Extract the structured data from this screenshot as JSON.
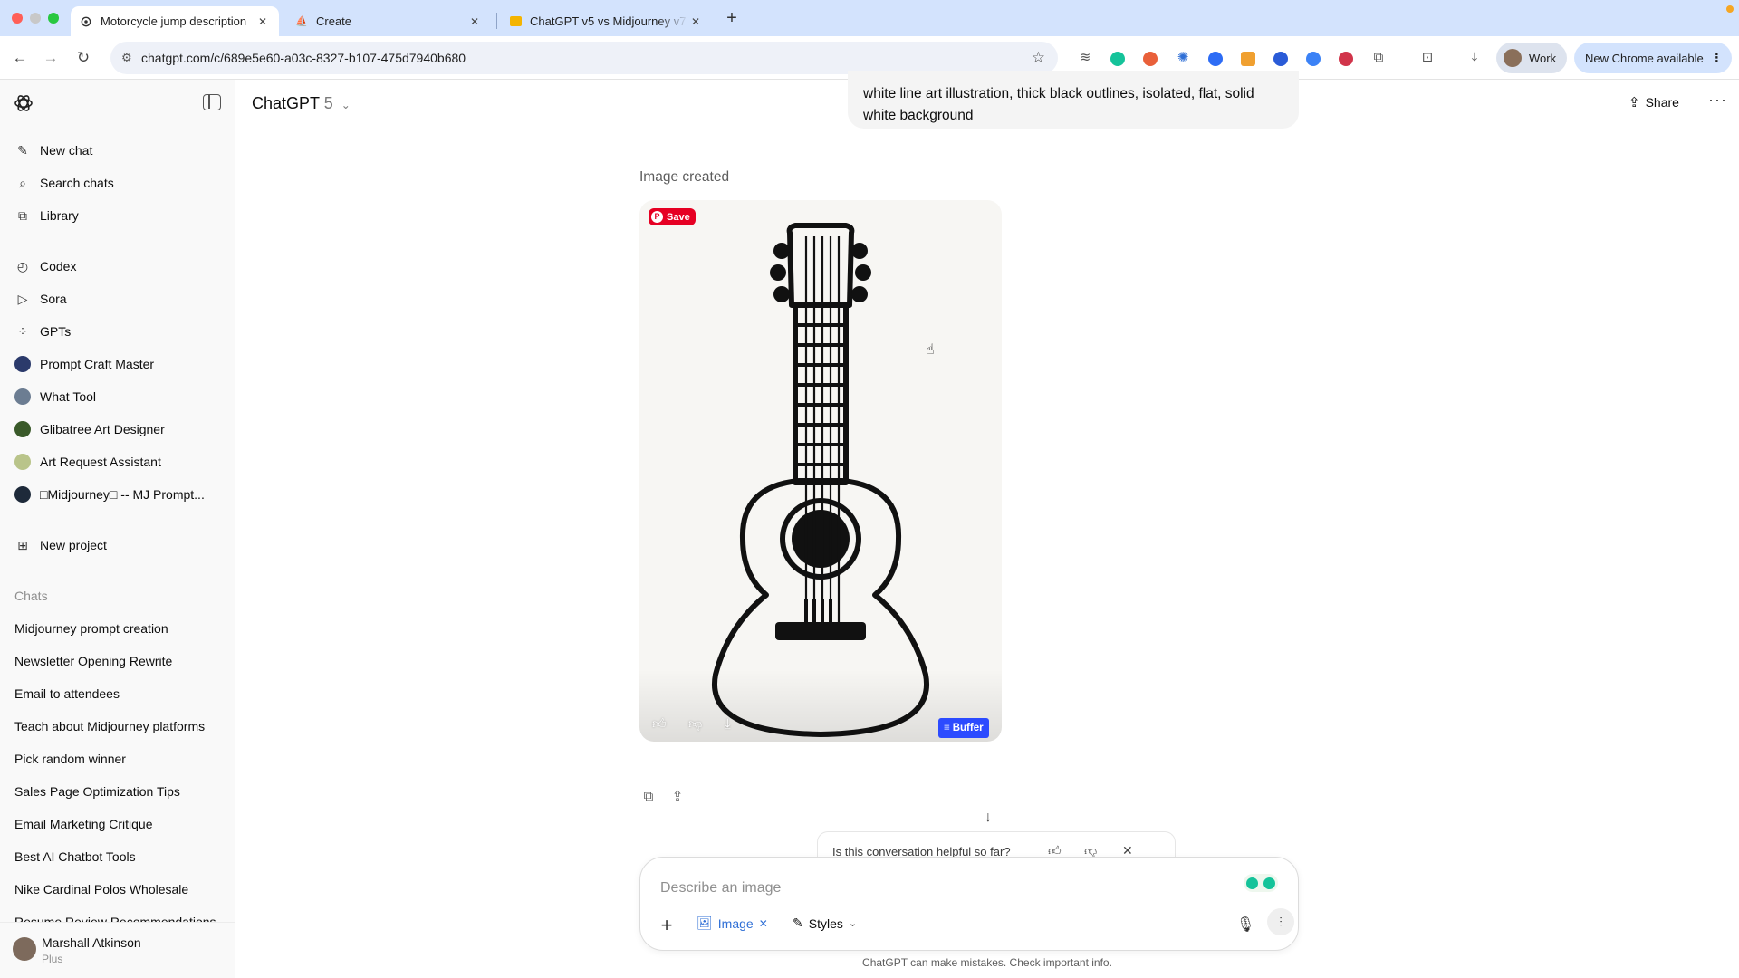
{
  "browser": {
    "tabs": [
      {
        "title": "Motorcycle jump description",
        "active": true,
        "icon": "openai-icon"
      },
      {
        "title": "Create",
        "active": false,
        "icon": "midjourney-icon"
      },
      {
        "title": "ChatGPT v5 vs Midjourney v7",
        "active": false,
        "icon": "slides-icon"
      }
    ],
    "new_tab_label": "+",
    "url": "chatgpt.com/c/689e5e60-a03c-8327-b107-475d7940b680",
    "profile_label": "Work",
    "update_label": "New Chrome available",
    "extensions": [
      "layers-icon",
      "grammarly-icon",
      "pinterest-icon",
      "gear-icon",
      "zoom-icon",
      "extension-icon",
      "tab-icon",
      "chrome-icon",
      "record-icon",
      "puzzle-icon"
    ]
  },
  "sidebar": {
    "top_items": [
      {
        "label": "New chat",
        "icon": "edit-icon"
      },
      {
        "label": "Search chats",
        "icon": "search-icon"
      },
      {
        "label": "Library",
        "icon": "library-icon"
      }
    ],
    "app_items": [
      {
        "label": "Codex",
        "icon": "codex-icon"
      },
      {
        "label": "Sora",
        "icon": "sora-icon"
      },
      {
        "label": "GPTs",
        "icon": "gpts-icon"
      }
    ],
    "gpts": [
      {
        "label": "Prompt Craft Master",
        "color": "#2b3a6b"
      },
      {
        "label": "What Tool",
        "color": "#6c7d92"
      },
      {
        "label": "Glibatree Art Designer",
        "color": "#3a5a2a"
      },
      {
        "label": "Art Request Assistant",
        "color": "#b9c48a"
      },
      {
        "label": "□Midjourney□ -- MJ Prompt...",
        "color": "#1e2a3a"
      }
    ],
    "new_project_label": "New project",
    "chats_heading": "Chats",
    "chats": [
      "Midjourney prompt creation",
      "Newsletter Opening Rewrite",
      "Email to attendees",
      "Teach about Midjourney platforms",
      "Pick random winner",
      "Sales Page Optimization Tips",
      "Email Marketing Critique",
      "Best AI Chatbot Tools",
      "Nike Cardinal Polos Wholesale",
      "Resume Review Recommendations"
    ],
    "user": {
      "name": "Marshall Atkinson",
      "plan": "Plus"
    }
  },
  "main": {
    "model_name": "ChatGPT",
    "model_version": "5",
    "share_label": "Share",
    "user_message": "white line art illustration, thick black outlines, isolated, flat, solid white background",
    "image_status": "Image created",
    "pin_save_label": "Save",
    "buffer_label": "Buffer",
    "feedback_question": "Is this conversation helpful so far?",
    "composer_placeholder": "Describe an image",
    "image_chip_label": "Image",
    "styles_label": "Styles",
    "disclaimer": "ChatGPT can make mistakes. Check important info."
  },
  "colors": {
    "sidebar_bg": "#f9f9f9",
    "tabbar_bg": "#d3e3fd",
    "accent_blue": "#2f6fd6",
    "pinterest_red": "#e60023",
    "buffer_blue": "#2c4bff"
  }
}
